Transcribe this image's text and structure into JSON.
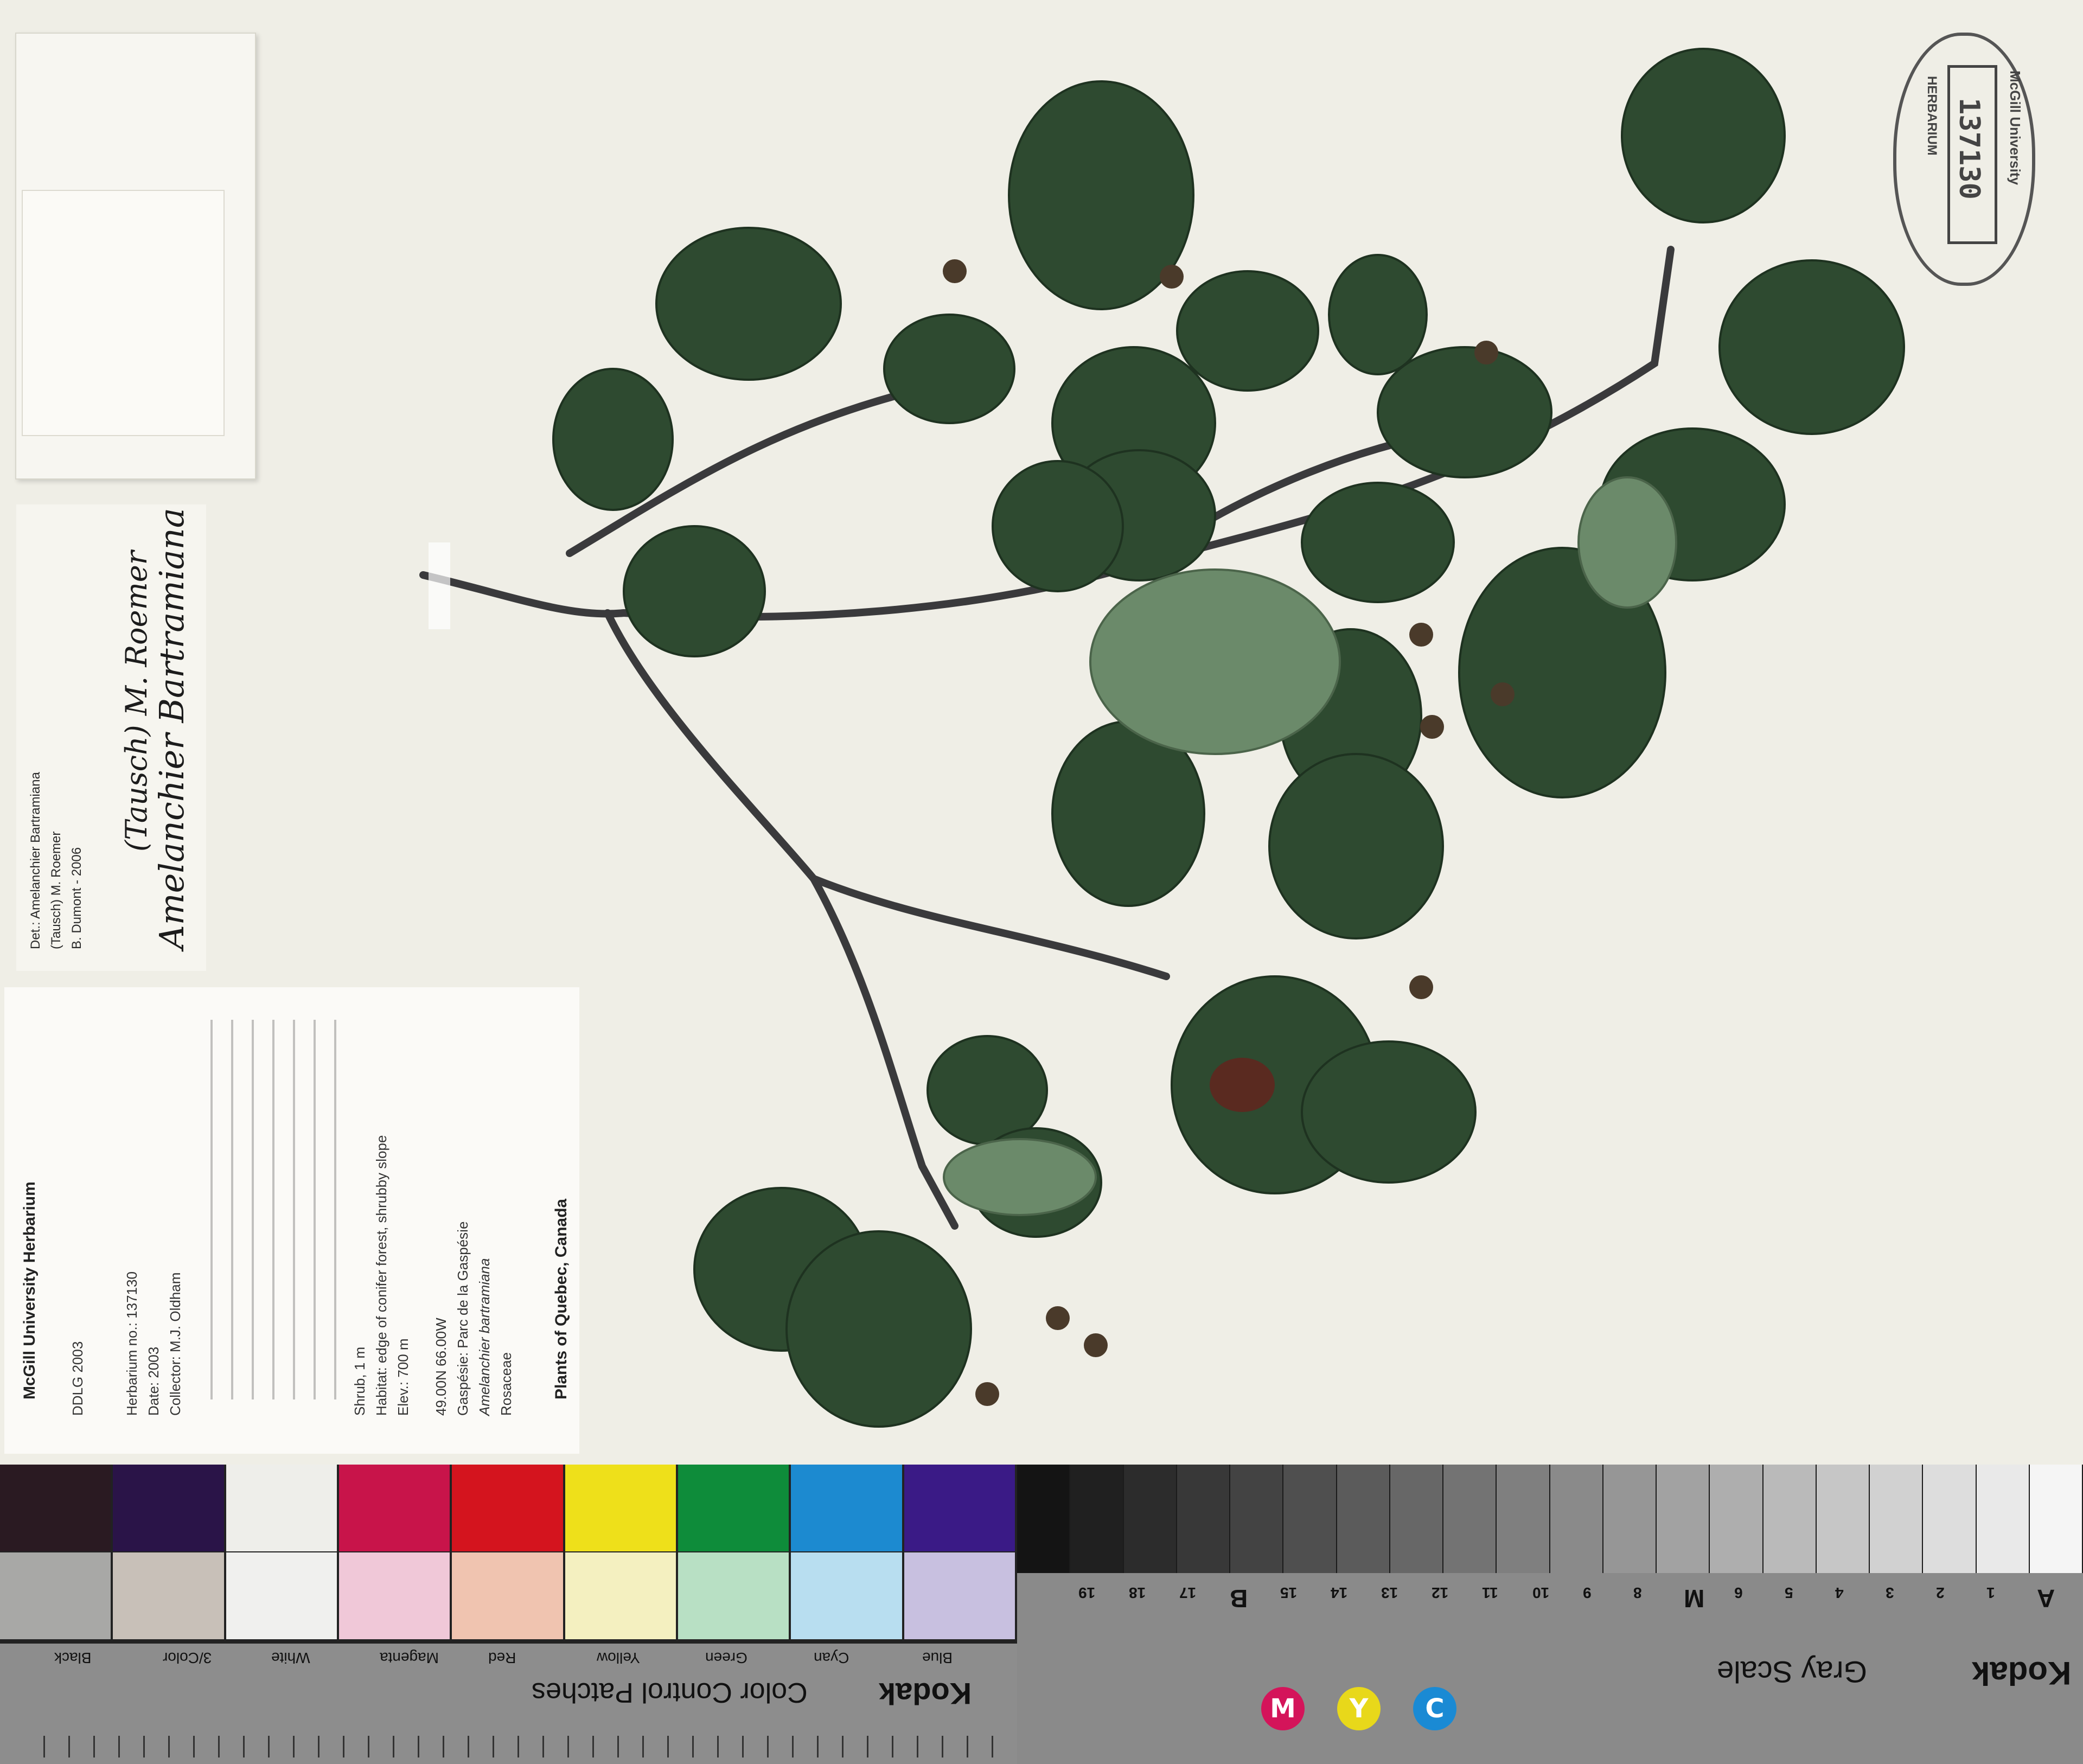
{
  "det_label": {
    "genus_handwritten": "Amelanchier Bartramiana",
    "author_handwritten": "(Tausch) M. Roemer",
    "det_line_1": "Det.: Amelanchier Bartramiana",
    "det_line_2": "(Tausch) M. Roemer",
    "det_line_3": "B. Dumont - 2006"
  },
  "main_label": {
    "heading": "Plants of Quebec, Canada",
    "lines": [
      "Rosaceae",
      "Amelanchier bartramiana",
      "Gaspésie: Parc de la Gaspésie",
      "49.00N 66.00W",
      "Elev.: 700 m",
      "Habitat: edge of conifer forest, shrubby slope",
      "Shrub, 1 m",
      "Collector: M.J. Oldham",
      "Date: 2003",
      "Herbarium no.: 137130"
    ],
    "footer_line_1": "McGill University Herbarium",
    "footer_line_2": "DDLG 2003"
  },
  "stamp": {
    "number": "137130",
    "institution": "McGill University",
    "herbarium": "HERBARIUM"
  },
  "color_card": {
    "brand": "Kodak",
    "title": "Color Control Patches",
    "patch_labels": [
      "Blue",
      "Cyan",
      "Green",
      "Yellow",
      "Red",
      "Magenta",
      "White",
      "3/Color",
      "Black"
    ],
    "top_colors": [
      "#2a1a22",
      "#2a1448",
      "#eeeeea",
      "#c8144a",
      "#d4141e",
      "#eee01a",
      "#0e8c3a",
      "#1c8ad0",
      "#3a1a86"
    ],
    "bottom_colors": [
      "#a8a8a6",
      "#c8c0b8",
      "#f0f0ee",
      "#f0c8d8",
      "#f0c4b0",
      "#f4f0c0",
      "#b8e0c4",
      "#b8def0",
      "#c8c0e0"
    ]
  },
  "gray_card": {
    "brand": "Kodak",
    "title": "Gray Scale",
    "scale_labels": [
      "A",
      "1",
      "2",
      "3",
      "4",
      "5",
      "6",
      "M",
      "8",
      "9",
      "10",
      "11",
      "12",
      "13",
      "14",
      "15",
      "B",
      "17",
      "18",
      "19"
    ],
    "cmy": [
      "C",
      "Y",
      "M"
    ],
    "cmy_colors": [
      "#1a8ad4",
      "#e8d81a",
      "#d4145a"
    ]
  }
}
